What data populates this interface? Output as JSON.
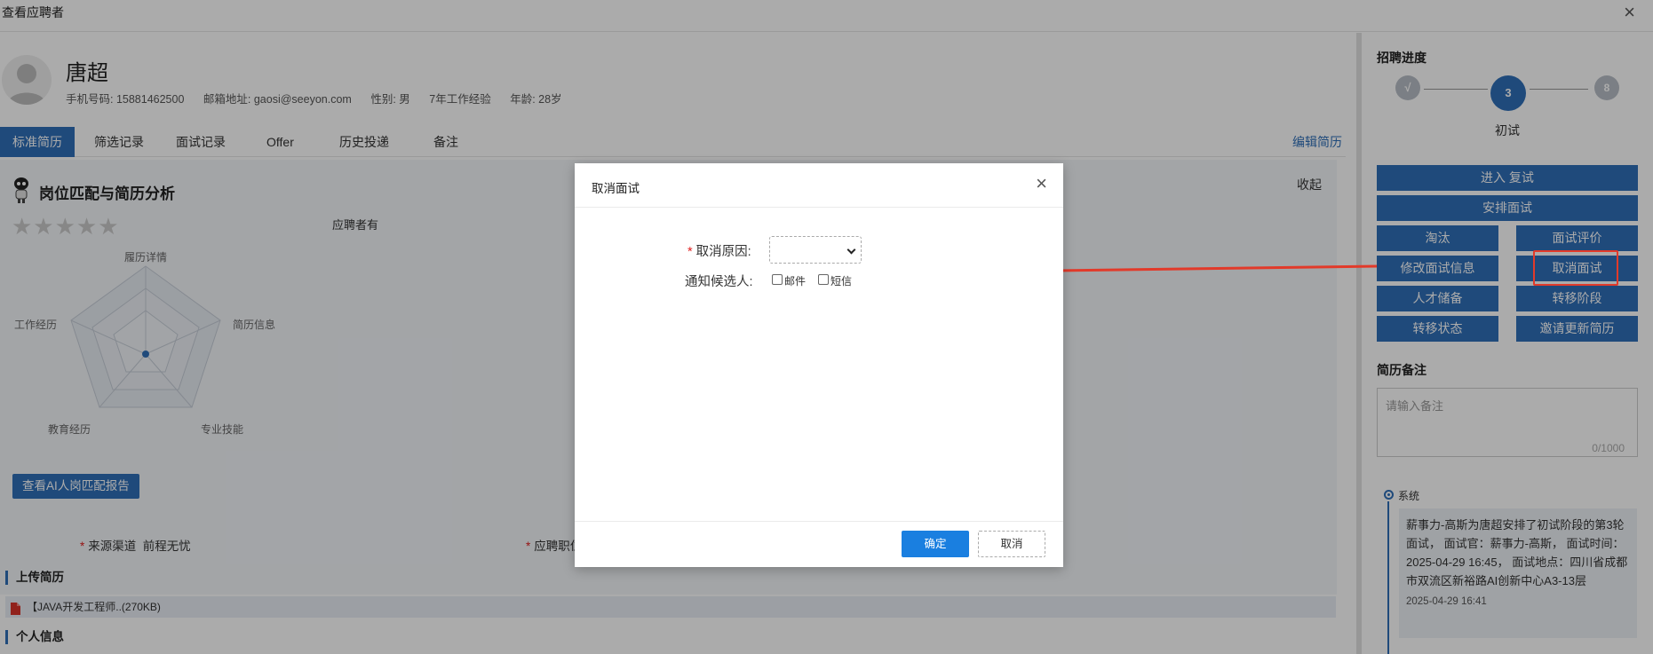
{
  "window": {
    "title": "查看应聘者",
    "close_glyph": "×"
  },
  "candidate": {
    "name": "唐超",
    "phone": "手机号码: 15881462500",
    "email": "邮箱地址: gaosi@seeyon.com",
    "gender": "性别: 男",
    "experience": "7年工作经验",
    "age": "年龄: 28岁"
  },
  "tabs": [
    {
      "label": "标准简历",
      "active": true
    },
    {
      "label": "筛选记录"
    },
    {
      "label": "面试记录"
    },
    {
      "label": "Offer"
    },
    {
      "label": "历史投递"
    },
    {
      "label": "备注"
    }
  ],
  "edit_resume": "编辑简历",
  "analysis": {
    "title": "岗位匹配与简历分析",
    "collapse": "收起",
    "stars": "★★★★★",
    "applicant_has": "应聘者有",
    "radar_labels": [
      "履历详情",
      "简历信息",
      "专业技能",
      "教育经历",
      "工作经历"
    ],
    "ai_button": "查看AI人岗匹配报告"
  },
  "fields": {
    "source_label": "来源渠道",
    "source_value": "前程无忧",
    "job_label": "应聘职位"
  },
  "upload": {
    "title": "上传简历",
    "file": "【JAVA开发工程师..(270KB)"
  },
  "personal_title": "个人信息",
  "progress": {
    "title": "招聘进度",
    "steps": [
      "√",
      "3",
      "8"
    ],
    "current_stage": "初试"
  },
  "actions": {
    "enter_retest": "进入 复试",
    "arrange_interview": "安排面试",
    "eliminate": "淘汰",
    "interview_eval": "面试评价",
    "modify_interview": "修改面试信息",
    "cancel_interview": "取消面试",
    "talent_reserve": "人才储备",
    "transfer_stage": "转移阶段",
    "transfer_status": "转移状态",
    "invite_update": "邀请更新简历"
  },
  "notes": {
    "title": "简历备注",
    "placeholder": "请输入备注",
    "counter": "0/1000"
  },
  "timeline": {
    "label": "系统",
    "text": "薪事力-高斯为唐超安排了初试阶段的第3轮面试， 面试官：薪事力-高斯， 面试时间：2025-04-29 16:45， 面试地点：四川省成都市双流区新裕路AI创新中心A3-13层",
    "time": "2025-04-29 16:41"
  },
  "dialog": {
    "title": "取消面试",
    "close_glyph": "×",
    "reason_label": "取消原因:",
    "notify_label": "通知候选人:",
    "opt_email": "邮件",
    "opt_sms": "短信",
    "ok": "确定",
    "cancel": "取消"
  },
  "colors": {
    "primary": "#2f6fb8",
    "button_blue": "#1a7fe0",
    "annotation_red": "#e23a2a"
  }
}
